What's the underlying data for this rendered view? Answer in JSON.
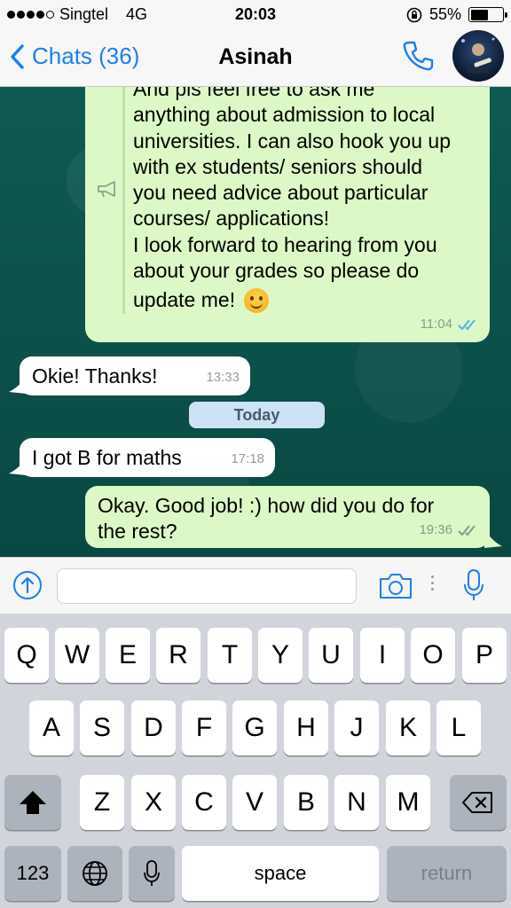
{
  "status_bar": {
    "carrier": "Singtel",
    "network": "4G",
    "time": "20:03",
    "battery_percent": "55%",
    "battery_level": 0.55,
    "signal_bars": 4
  },
  "nav": {
    "back_label": "Chats (36)",
    "title": "Asinah"
  },
  "messages": {
    "long_outgoing": {
      "lines": [
        "And pls feel free to ask me",
        "anything about admission to local",
        "universities. I can also hook you up",
        "with ex students/ seniors should",
        "you need advice about particular",
        "courses/ applications!",
        "I look forward to hearing from you",
        "about your grades so please do"
      ],
      "last_line": "update me!",
      "time": "11:04"
    },
    "okie": {
      "text": "Okie! Thanks!",
      "time": "13:33"
    },
    "date_divider": "Today",
    "maths": {
      "text": "I got B for maths",
      "time": "17:18"
    },
    "good_job": {
      "line1": "Okay. Good job! :) how did you do for",
      "line2": "the rest?",
      "time": "19:36"
    }
  },
  "input": {
    "value": "",
    "placeholder": ""
  },
  "keyboard": {
    "row1": [
      "Q",
      "W",
      "E",
      "R",
      "T",
      "Y",
      "U",
      "I",
      "O",
      "P"
    ],
    "row2": [
      "A",
      "S",
      "D",
      "F",
      "G",
      "H",
      "J",
      "K",
      "L"
    ],
    "row3": [
      "Z",
      "X",
      "C",
      "V",
      "B",
      "N",
      "M"
    ],
    "numbers_label": "123",
    "space_label": "space",
    "return_label": "return"
  },
  "colors": {
    "accent": "#1a7ef5",
    "outgoing_bubble": "#dcf8c6",
    "incoming_bubble": "#ffffff",
    "chat_background": "#0b4f4a",
    "read_ticks": "#4fb3f0"
  }
}
